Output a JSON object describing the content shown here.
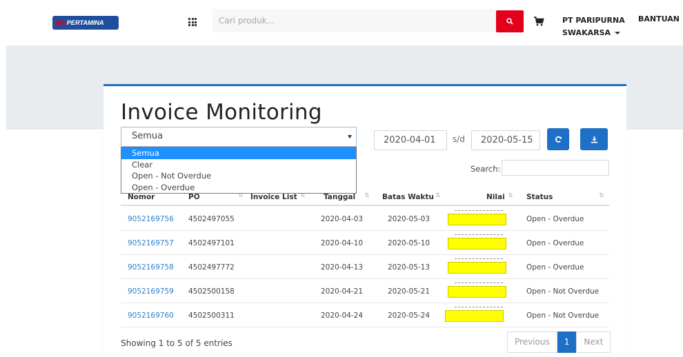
{
  "header": {
    "logo_my": "My",
    "logo_rest": "PERTAMINA",
    "search_placeholder": "Cari produk...",
    "company_line1": "PT PARIPURNA",
    "company_line2": "SWAKARSA",
    "help": "BANTUAN"
  },
  "page": {
    "title": "Invoice Monitoring",
    "filter_value": "Semua",
    "filter_options": [
      "Semua",
      "Clear",
      "Open - Not Overdue",
      "Open - Overdue"
    ],
    "date_from": "2020-04-01",
    "date_separator": "s/d",
    "date_to": "2020-05-15",
    "search_label": "Search:"
  },
  "table": {
    "headers": [
      "Nomor",
      "PO",
      "Invoice List",
      "Tanggal",
      "Batas Waktu",
      "Nilai",
      "Status"
    ],
    "rows": [
      {
        "nomor": "9052169756",
        "po": "4502497055",
        "tanggal": "2020-04-03",
        "batas": "2020-05-03",
        "status": "Open - Overdue"
      },
      {
        "nomor": "9052169757",
        "po": "4502497101",
        "tanggal": "2020-04-10",
        "batas": "2020-05-10",
        "status": "Open - Overdue"
      },
      {
        "nomor": "9052169758",
        "po": "4502497772",
        "tanggal": "2020-04-13",
        "batas": "2020-05-13",
        "status": "Open - Overdue"
      },
      {
        "nomor": "9052169759",
        "po": "4502500158",
        "tanggal": "2020-04-21",
        "batas": "2020-05-21",
        "status": "Open - Not Overdue"
      },
      {
        "nomor": "9052169760",
        "po": "4502500311",
        "tanggal": "2020-04-24",
        "batas": "2020-05-24",
        "status": "Open - Not Overdue"
      }
    ]
  },
  "footer": {
    "info": "Showing 1 to 5 of 5 entries",
    "prev": "Previous",
    "page": "1",
    "next": "Next"
  },
  "colors": {
    "brand_red": "#e3001b",
    "brand_blue": "#1e6fc6",
    "link": "#2f7ec7",
    "redaction": "#ffff00"
  },
  "icons": [
    "apps-grid-icon",
    "search-icon",
    "cart-icon",
    "refresh-icon",
    "download-icon",
    "sort-icon"
  ]
}
